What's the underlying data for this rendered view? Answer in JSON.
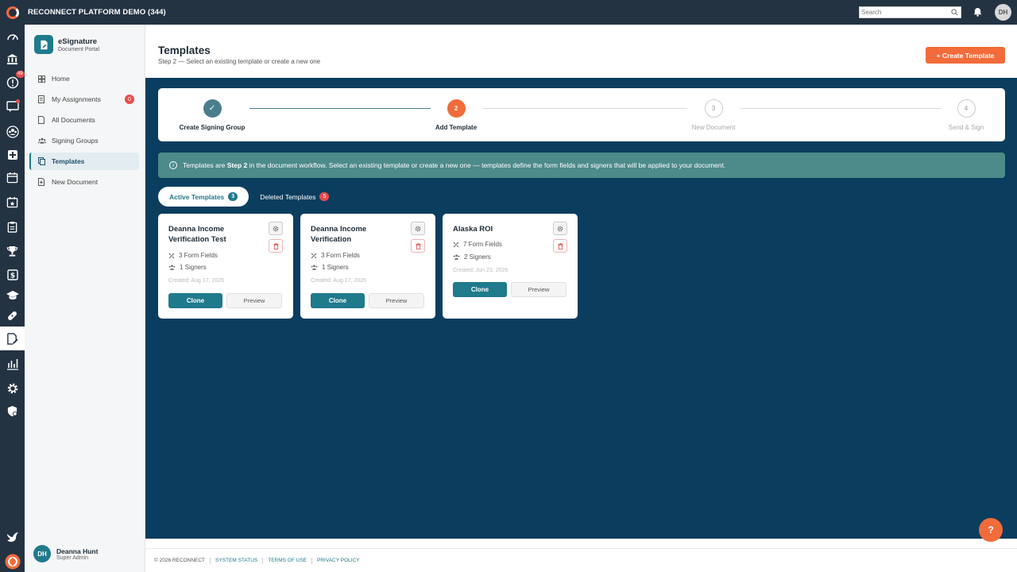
{
  "app": {
    "title": "RECONNECT PLATFORM DEMO (344)",
    "search_placeholder": "Search",
    "user_initials": "DH"
  },
  "rail": {
    "notifications_badge": "49"
  },
  "sidebar": {
    "app_name": "eSignature",
    "app_subtitle": "Document Portal",
    "items": [
      {
        "label": "Home"
      },
      {
        "label": "My Assignments",
        "count": "0"
      },
      {
        "label": "All Documents"
      },
      {
        "label": "Signing Groups"
      },
      {
        "label": "Templates"
      },
      {
        "label": "New Document"
      }
    ],
    "user": {
      "initials": "DH",
      "name": "Deanna Hunt",
      "role": "Super Admin"
    }
  },
  "header": {
    "title": "Templates",
    "subtitle": "Step 2 — Select an existing template or create a new one",
    "create_label": "+ Create Template"
  },
  "stepper": {
    "steps": [
      {
        "num": "✓",
        "label": "Create Signing Group",
        "state": "done"
      },
      {
        "num": "2",
        "label": "Add Template",
        "state": "current"
      },
      {
        "num": "3",
        "label": "New Document",
        "state": "pending"
      },
      {
        "num": "4",
        "label": "Send & Sign",
        "state": "pending"
      }
    ]
  },
  "info": {
    "prefix": "Templates are ",
    "bold": "Step 2",
    "suffix": " in the document workflow. Select an existing template or create a new one — templates define the form fields and signers that will be applied to your document."
  },
  "tabs": {
    "active": {
      "label": "Active Templates",
      "count": "3"
    },
    "deleted": {
      "label": "Deleted Templates",
      "count": "5"
    }
  },
  "templates": [
    {
      "title": "Deanna Income Verification Test",
      "fields": "3 Form Fields",
      "signers": "1 Signers",
      "created": "Created: Aug 17, 2026",
      "clone": "Clone",
      "preview": "Preview"
    },
    {
      "title": "Deanna Income Verification",
      "fields": "3 Form Fields",
      "signers": "1 Signers",
      "created": "Created: Aug 17, 2026",
      "clone": "Clone",
      "preview": "Preview"
    },
    {
      "title": "Alaska ROI",
      "fields": "7 Form Fields",
      "signers": "2 Signers",
      "created": "Created: Jun 23, 2026",
      "clone": "Clone",
      "preview": "Preview"
    }
  ],
  "help_label": "?",
  "footer": {
    "copyright": "© 2026 RECONNECT",
    "links": [
      "SYSTEM STATUS",
      "TERMS OF USE",
      "PRIVACY POLICY"
    ]
  },
  "colors": {
    "topbar": "#233342",
    "main_bg": "#0b3d5e",
    "accent": "#f26b3a",
    "teal": "#1f7a8c",
    "danger": "#e84c4c"
  }
}
